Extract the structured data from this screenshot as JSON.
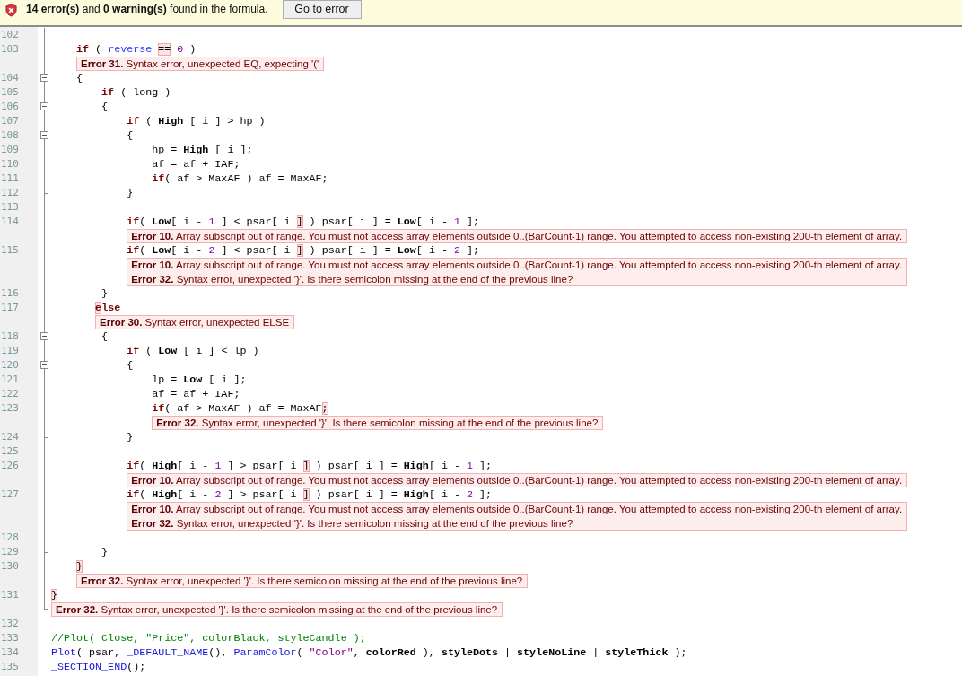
{
  "error_bar": {
    "summary": "**14 error(s)** and **0 warning(s)** found in the formula.",
    "button": "Go to error"
  },
  "lines": [
    {
      "num": "102",
      "kind": "mid"
    },
    {
      "num": "103",
      "kind": "mid",
      "tokens": [
        {
          "kind": "kw",
          "text": "\tif"
        },
        {
          "kind": "plain",
          "text": " ( "
        },
        {
          "kind": "var",
          "text": "reverse "
        },
        {
          "kind": "plain",
          "text": "==",
          "flagged": true
        },
        {
          "kind": "num",
          "text": " 0"
        },
        {
          "kind": "plain",
          "text": " )"
        }
      ],
      "errors": [
        {
          "code": "Error 31.",
          "message": "Syntax error, unexpected EQ, expecting '('"
        }
      ]
    },
    {
      "num": "104",
      "kind": "start",
      "tokens": [
        {
          "kind": "plain",
          "text": "\t{"
        }
      ]
    },
    {
      "num": "105",
      "kind": "mid",
      "tokens": [
        {
          "kind": "kw",
          "text": "\t\tif"
        },
        {
          "kind": "plain",
          "text": " ( long )"
        }
      ]
    },
    {
      "num": "106",
      "kind": "start",
      "tokens": [
        {
          "kind": "plain",
          "text": "\t\t{"
        }
      ]
    },
    {
      "num": "107",
      "kind": "mid",
      "tokens": [
        {
          "kind": "kw",
          "text": "\t\t\tif"
        },
        {
          "kind": "plain",
          "text": " ( "
        },
        {
          "kind": "bi",
          "text": "High"
        },
        {
          "kind": "plain",
          "text": " [ i ] > hp )"
        }
      ]
    },
    {
      "num": "108",
      "kind": "start",
      "tokens": [
        {
          "kind": "plain",
          "text": "\t\t\t{"
        }
      ]
    },
    {
      "num": "109",
      "kind": "mid",
      "tokens": [
        {
          "kind": "plain",
          "text": "\t\t\t\thp = "
        },
        {
          "kind": "bi",
          "text": "High"
        },
        {
          "kind": "plain",
          "text": " [ i ];"
        }
      ]
    },
    {
      "num": "110",
      "kind": "mid",
      "tokens": [
        {
          "kind": "plain",
          "text": "\t\t\t\taf = af + IAF;"
        }
      ]
    },
    {
      "num": "111",
      "kind": "mid",
      "tokens": [
        {
          "kind": "kw",
          "text": "\t\t\t\tif"
        },
        {
          "kind": "plain",
          "text": "( af > MaxAF ) af = MaxAF;"
        }
      ]
    },
    {
      "num": "112",
      "kind": "end",
      "tokens": [
        {
          "kind": "plain",
          "text": "\t\t\t}"
        }
      ]
    },
    {
      "num": "113",
      "kind": "mid"
    },
    {
      "num": "114",
      "kind": "mid",
      "tokens": [
        {
          "kind": "kw",
          "text": "\t\t\tif"
        },
        {
          "kind": "plain",
          "text": "( "
        },
        {
          "kind": "bi",
          "text": "Low"
        },
        {
          "kind": "plain",
          "text": "[ i - "
        },
        {
          "kind": "num",
          "text": "1"
        },
        {
          "kind": "plain",
          "text": " ] < psar[ i "
        },
        {
          "kind": "plain",
          "text": "]",
          "flagged": true
        },
        {
          "kind": "plain",
          "text": " ) psar[ i ] = "
        },
        {
          "kind": "bi",
          "text": "Low"
        },
        {
          "kind": "plain",
          "text": "[ i - "
        },
        {
          "kind": "num",
          "text": "1"
        },
        {
          "kind": "plain",
          "text": " ];"
        }
      ],
      "errors": [
        {
          "code": "Error 10.",
          "message": "Array subscript out of range. You must not access array elements outside 0..(BarCount-1) range. You attempted to access non-existing 200-th element of array."
        }
      ]
    },
    {
      "num": "115",
      "kind": "mid",
      "tokens": [
        {
          "kind": "kw",
          "text": "\t\t\tif"
        },
        {
          "kind": "plain",
          "text": "( "
        },
        {
          "kind": "bi",
          "text": "Low"
        },
        {
          "kind": "plain",
          "text": "[ i - "
        },
        {
          "kind": "num",
          "text": "2"
        },
        {
          "kind": "plain",
          "text": " ] < psar[ i "
        },
        {
          "kind": "plain",
          "text": "]",
          "flagged": true
        },
        {
          "kind": "plain",
          "text": " ) psar[ i ] = "
        },
        {
          "kind": "bi",
          "text": "Low"
        },
        {
          "kind": "plain",
          "text": "[ i - "
        },
        {
          "kind": "num",
          "text": "2"
        },
        {
          "kind": "plain",
          "text": " ];"
        }
      ],
      "errors": [
        {
          "code": "Error 10.",
          "message": "Array subscript out of range. You must not access array elements outside 0..(BarCount-1) range. You attempted to access non-existing 200-th element of array."
        },
        {
          "code": "Error 32.",
          "message": "Syntax error, unexpected '}'. Is there semicolon missing at the end of the previous line?"
        }
      ]
    },
    {
      "num": "116",
      "kind": "end",
      "tokens": [
        {
          "kind": "plain",
          "text": "\t\t}"
        }
      ]
    },
    {
      "num": "117",
      "kind": "mid",
      "tokens": [
        {
          "kind": "kw",
          "text": "\t   e",
          "flagged": true
        },
        {
          "kind": "kw",
          "text": "lse"
        }
      ],
      "errors": [
        {
          "code": "Error 30.",
          "message": "Syntax error, unexpected ELSE"
        }
      ]
    },
    {
      "num": "118",
      "kind": "start",
      "tokens": [
        {
          "kind": "plain",
          "text": "\t\t{"
        }
      ]
    },
    {
      "num": "119",
      "kind": "mid",
      "tokens": [
        {
          "kind": "kw",
          "text": "\t\t\tif"
        },
        {
          "kind": "plain",
          "text": " ( "
        },
        {
          "kind": "bi",
          "text": "Low"
        },
        {
          "kind": "plain",
          "text": " [ i ] < lp )"
        }
      ]
    },
    {
      "num": "120",
      "kind": "start",
      "tokens": [
        {
          "kind": "plain",
          "text": "\t\t\t{"
        }
      ]
    },
    {
      "num": "121",
      "kind": "mid",
      "tokens": [
        {
          "kind": "plain",
          "text": "\t\t\t\tlp = "
        },
        {
          "kind": "bi",
          "text": "Low"
        },
        {
          "kind": "plain",
          "text": " [ i ];"
        }
      ]
    },
    {
      "num": "122",
      "kind": "mid",
      "tokens": [
        {
          "kind": "plain",
          "text": "\t\t\t\taf = af + IAF;"
        }
      ]
    },
    {
      "num": "123",
      "kind": "mid",
      "tokens": [
        {
          "kind": "kw",
          "text": "\t\t\t\tif"
        },
        {
          "kind": "plain",
          "text": "( af > MaxAF ) af = MaxAF"
        },
        {
          "kind": "plain",
          "text": ";",
          "flagged": true
        }
      ],
      "errors": [
        {
          "code": "Error 32.",
          "message": "Syntax error, unexpected '}'. Is there semicolon missing at the end of the previous line?"
        }
      ]
    },
    {
      "num": "124",
      "kind": "end",
      "tokens": [
        {
          "kind": "plain",
          "text": "\t\t\t}"
        }
      ]
    },
    {
      "num": "125",
      "kind": "mid"
    },
    {
      "num": "126",
      "kind": "mid",
      "tokens": [
        {
          "kind": "kw",
          "text": "\t\t\tif"
        },
        {
          "kind": "plain",
          "text": "( "
        },
        {
          "kind": "bi",
          "text": "High"
        },
        {
          "kind": "plain",
          "text": "[ i - "
        },
        {
          "kind": "num",
          "text": "1"
        },
        {
          "kind": "plain",
          "text": " ] > psar[ i "
        },
        {
          "kind": "plain",
          "text": "]",
          "flagged": true
        },
        {
          "kind": "plain",
          "text": " ) psar[ i ] = "
        },
        {
          "kind": "bi",
          "text": "High"
        },
        {
          "kind": "plain",
          "text": "[ i - "
        },
        {
          "kind": "num",
          "text": "1"
        },
        {
          "kind": "plain",
          "text": " ];"
        }
      ],
      "errors": [
        {
          "code": "Error 10.",
          "message": "Array subscript out of range. You must not access array elements outside 0..(BarCount-1) range. You attempted to access non-existing 200-th element of array."
        }
      ]
    },
    {
      "num": "127",
      "kind": "mid",
      "tokens": [
        {
          "kind": "kw",
          "text": "\t\t\tif"
        },
        {
          "kind": "plain",
          "text": "( "
        },
        {
          "kind": "bi",
          "text": "High"
        },
        {
          "kind": "plain",
          "text": "[ i - "
        },
        {
          "kind": "num",
          "text": "2"
        },
        {
          "kind": "plain",
          "text": " ] > psar[ i "
        },
        {
          "kind": "plain",
          "text": "]",
          "flagged": true
        },
        {
          "kind": "plain",
          "text": " ) psar[ i ] = "
        },
        {
          "kind": "bi",
          "text": "High"
        },
        {
          "kind": "plain",
          "text": "[ i - "
        },
        {
          "kind": "num",
          "text": "2"
        },
        {
          "kind": "plain",
          "text": " ];"
        }
      ],
      "errors": [
        {
          "code": "Error 10.",
          "message": "Array subscript out of range. You must not access array elements outside 0..(BarCount-1) range. You attempted to access non-existing 200-th element of array."
        },
        {
          "code": "Error 32.",
          "message": "Syntax error, unexpected '}'. Is there semicolon missing at the end of the previous line?"
        }
      ]
    },
    {
      "num": "128",
      "kind": "mid"
    },
    {
      "num": "129",
      "kind": "end",
      "tokens": [
        {
          "kind": "plain",
          "text": "\t\t}"
        }
      ]
    },
    {
      "num": "130",
      "kind": "mid",
      "tokens": [
        {
          "kind": "plain",
          "text": "\t}",
          "flagged": true
        }
      ],
      "errors": [
        {
          "code": "Error 32.",
          "message": "Syntax error, unexpected '}'. Is there semicolon missing at the end of the previous line?"
        }
      ]
    },
    {
      "num": "131",
      "kind": "last",
      "tokens": [
        {
          "kind": "plain",
          "text": "}",
          "flagged": true
        }
      ],
      "errors": [
        {
          "code": "Error 32.",
          "message": "Syntax error, unexpected '}'. Is there semicolon missing at the end of the previous line?"
        }
      ]
    },
    {
      "num": "132"
    },
    {
      "num": "133",
      "tokens": [
        {
          "kind": "comment",
          "text": "//Plot( Close, \"Price\", colorBlack, styleCandle );"
        }
      ]
    },
    {
      "num": "134",
      "tokens": [
        {
          "kind": "func",
          "text": "Plot"
        },
        {
          "kind": "plain",
          "text": "( psar, "
        },
        {
          "kind": "func",
          "text": "_DEFAULT_NAME"
        },
        {
          "kind": "plain",
          "text": "(), "
        },
        {
          "kind": "func",
          "text": "ParamColor"
        },
        {
          "kind": "plain",
          "text": "( "
        },
        {
          "kind": "str",
          "text": "\"Color\""
        },
        {
          "kind": "plain",
          "text": ", "
        },
        {
          "kind": "bi",
          "text": "colorRed"
        },
        {
          "kind": "plain",
          "text": " ), "
        },
        {
          "kind": "bi",
          "text": "styleDots"
        },
        {
          "kind": "plain",
          "text": " | "
        },
        {
          "kind": "bi",
          "text": "styleNoLine"
        },
        {
          "kind": "plain",
          "text": " | "
        },
        {
          "kind": "bi",
          "text": "styleThick"
        },
        {
          "kind": "plain",
          "text": " );"
        }
      ]
    },
    {
      "num": "135",
      "tokens": [
        {
          "kind": "func",
          "text": "_SECTION_END"
        },
        {
          "kind": "plain",
          "text": "();"
        }
      ]
    }
  ]
}
